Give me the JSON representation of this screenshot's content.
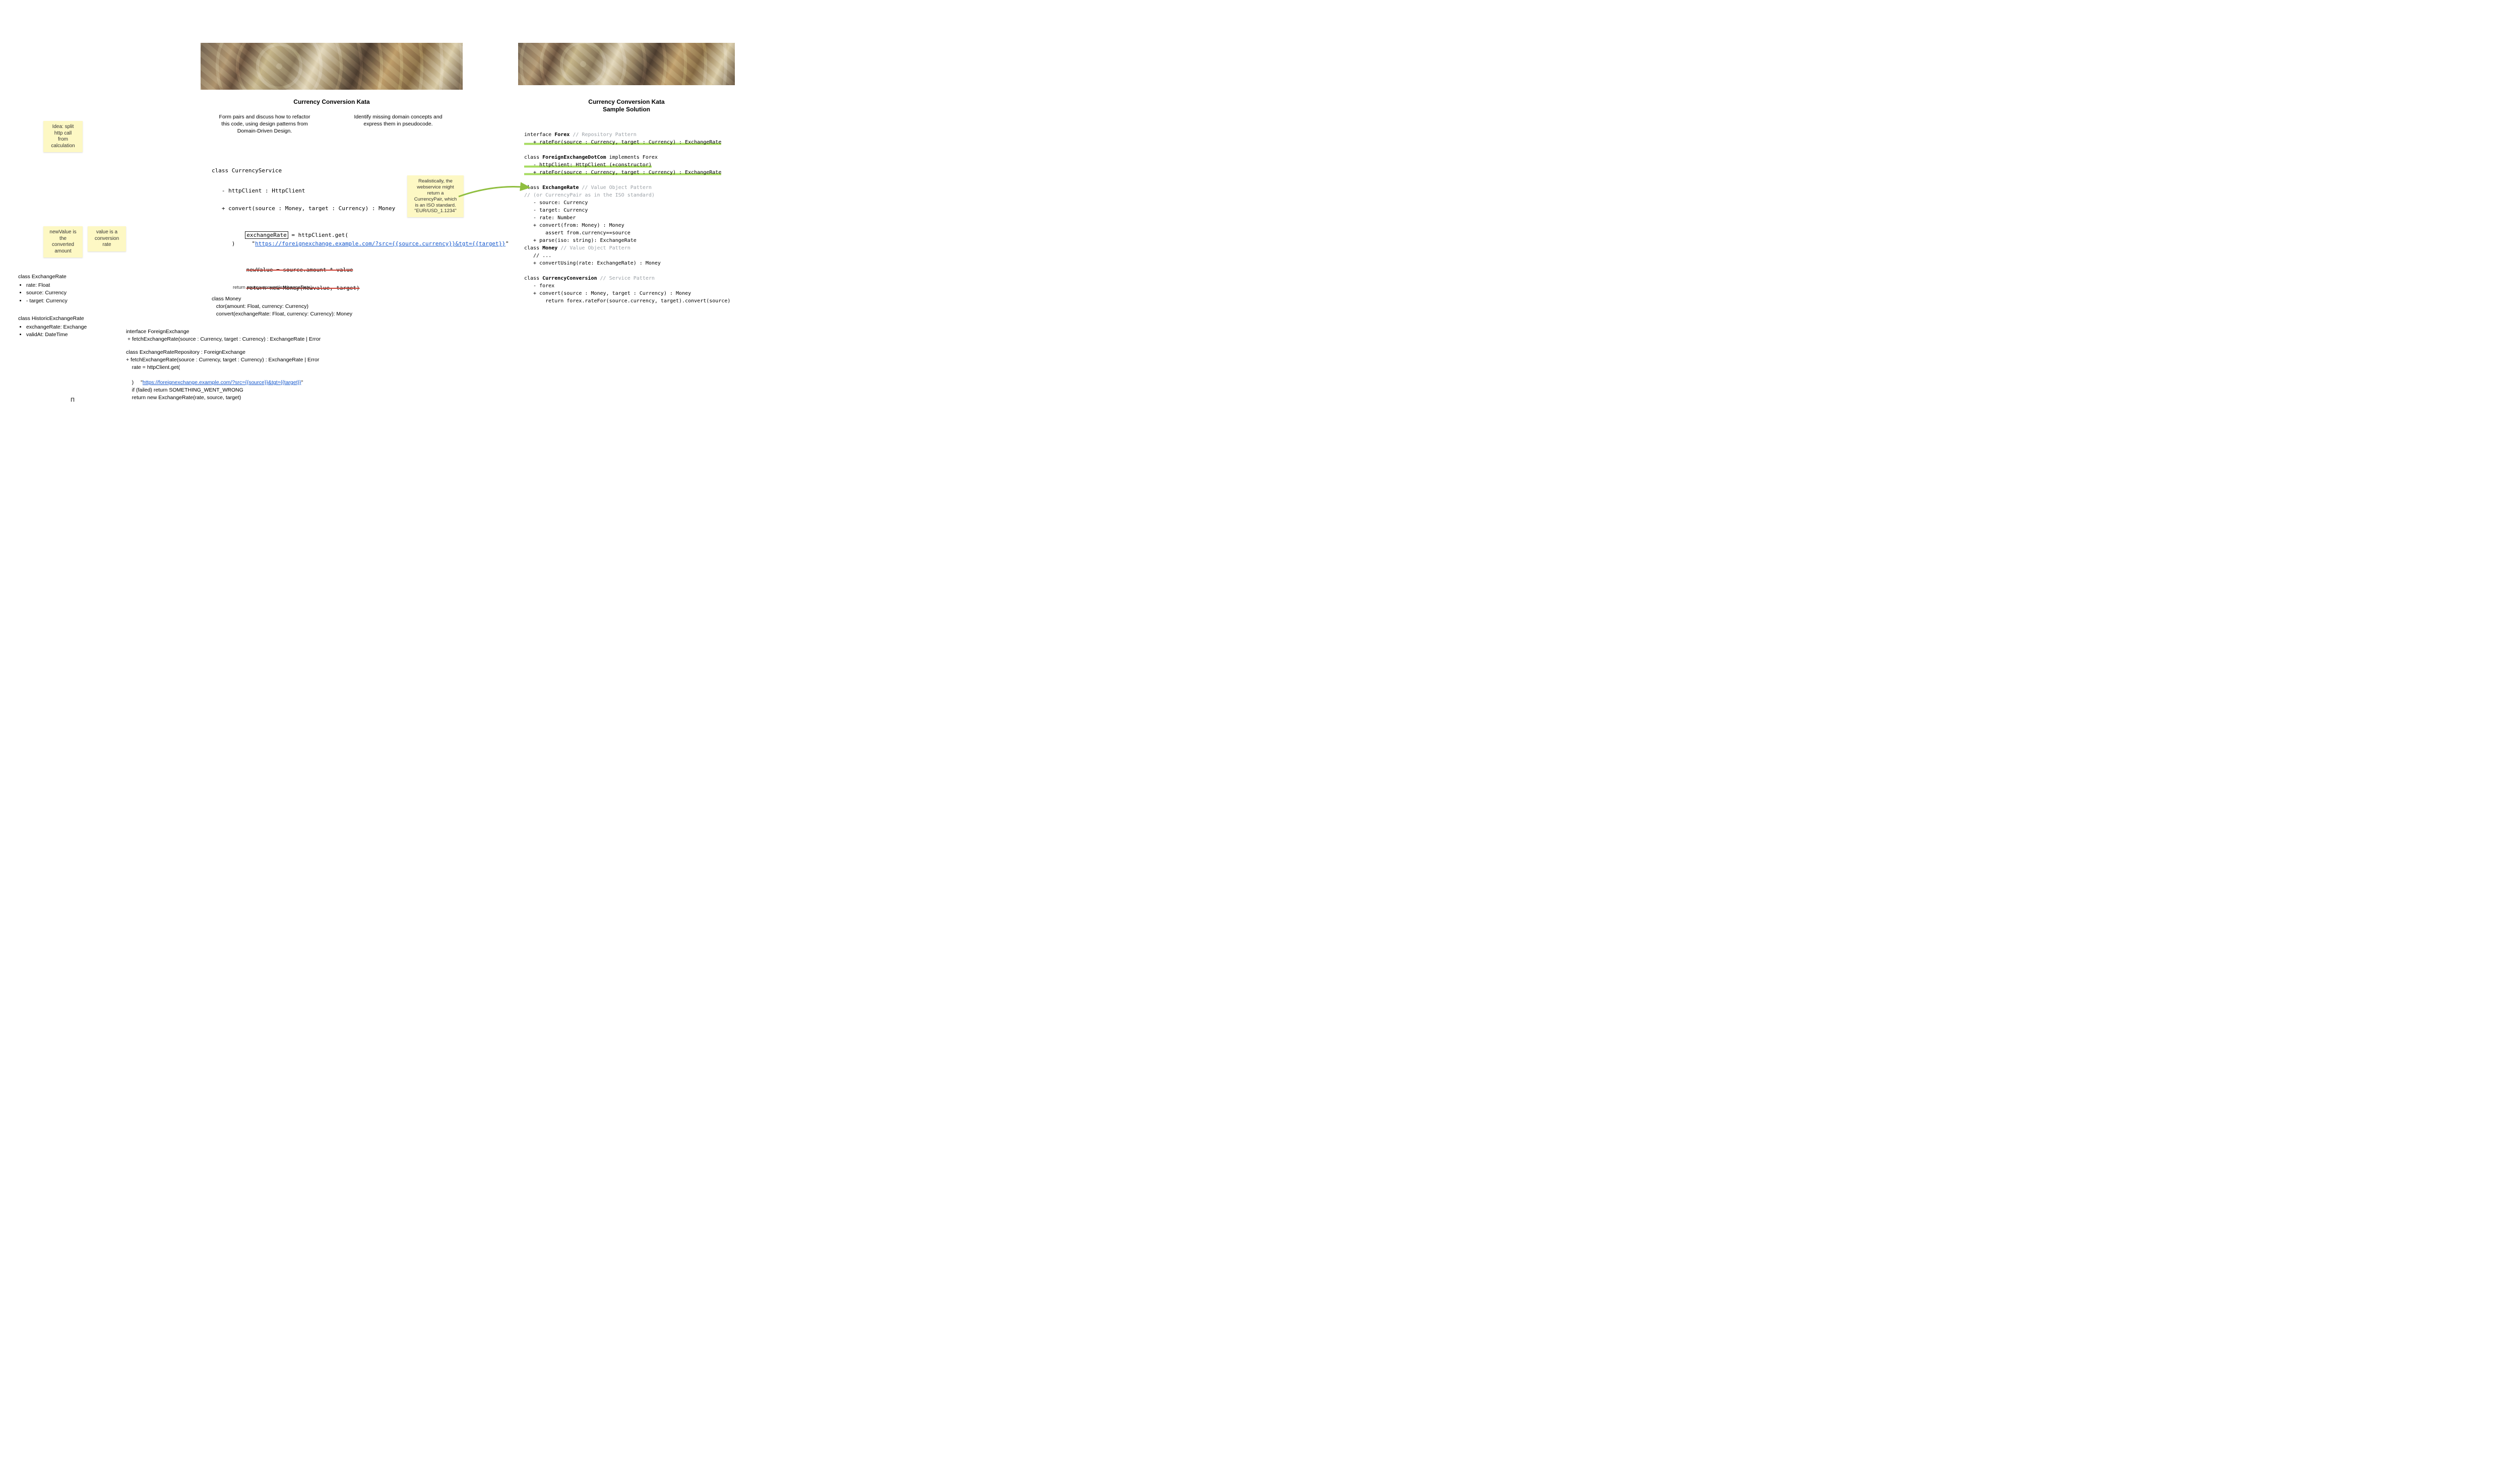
{
  "stickies": {
    "idea": "Idea: split\nhttp call\nfrom\ncalculation",
    "newValue": "newValue is\nthe\nconverted\namount",
    "valueRate": "value is a\nconversion\nrate",
    "currencyPair": "Realistically, the\nwebservice might\nreturn a\nCurrencyPair, which\nis an ISO standard.\n\"EUR/USD_1.1234\""
  },
  "leftPanel": {
    "title": "Currency Conversion Kata",
    "instrLeft": "Form pairs and discuss how to refactor\nthis code, using design patterns from\nDomain-Driven Design.",
    "instrRight": "Identify missing domain concepts and\nexpress them in pseudocode.",
    "codeHeader": "class CurrencyService",
    "field1": "   - httpClient : HttpClient",
    "method1": "   + convert(source : Money, target : Currency) : Money",
    "boxedVar": "exchangeRate",
    "httpPrefix": " = httpClient.get(",
    "urlLine": "        \"",
    "url": "https://foreignexchange.example.com/?src={{source.currency}}&tgt={{target}}",
    "urlSuffix": "\"",
    "closeParen": "      )",
    "strike1": "newValue = source.amount * value",
    "strike2": "return new Money(newvalue, target)",
    "rewrite": "return source.convert(exchangeRate)",
    "moneyBlock": "class Money\n   ctor(amount: Float, currency: Currency)\n   convert(exchangeRate: Float, currency: Currency): Money",
    "interfaceBlock": "interface ForeignExchange\n + fetchExchangeRate(source : Currency, target : Currency) : ExchangeRate | Error",
    "repoHeader": "class ExchangeRateRepository : ForeignExchange\n+ fetchExchangeRate(source : Currency, target : Currency) : ExchangeRate | Error\n    rate = httpClient.get(",
    "repoUrlPrefix": "      \"",
    "repoUrl": "https://foreignexchange.example.com/?src={{source}}&tgt={{target}}",
    "repoUrlSuffix": "\"",
    "repoTail": "    )\n    if (failed) return SOMETHING_WENT_WRONG\n    return new ExchangeRate(rate, source, target)"
  },
  "sideLists": {
    "exRate": {
      "header": "class ExchangeRate",
      "items": [
        "rate: Float",
        "source: Currency",
        "- target: Currency"
      ]
    },
    "hist": {
      "header": "class HistoricExchangeRate",
      "items": [
        "exchangeRate: Exchange",
        "validAt: DateTime"
      ]
    }
  },
  "rightPanel": {
    "title1": "Currency Conversion Kata",
    "title2": "Sample Solution",
    "lines": [
      {
        "t": "plain",
        "pre": "interface ",
        "kw": "Forex",
        "post": " ",
        "cm": "// Repository Pattern"
      },
      {
        "t": "hl",
        "text": "   + rateFor(source : Currency, target : Currency) : ExchangeRate"
      },
      {
        "t": "blank"
      },
      {
        "t": "plain",
        "pre": "class ",
        "kw": "ForeignExchangeDotCom",
        "post": " implements Forex"
      },
      {
        "t": "hl",
        "text": "   - httpClient: HttpClient (+constructor)"
      },
      {
        "t": "hl",
        "text": "   + rateFor(source : Currency, target : Currency) : ExchangeRate"
      },
      {
        "t": "blank"
      },
      {
        "t": "plain",
        "pre": "class ",
        "kw": "ExchangeRate",
        "post": " ",
        "cm": "// Value Object Pattern"
      },
      {
        "t": "cm",
        "text": "// (or CurrencyPair as in the ISO standard)"
      },
      {
        "t": "raw",
        "text": "   - source: Currency"
      },
      {
        "t": "raw",
        "text": "   - target: Currency"
      },
      {
        "t": "raw",
        "text": "   - rate: Number"
      },
      {
        "t": "raw",
        "text": "   + convert(from: Money) : Money"
      },
      {
        "t": "raw",
        "text": "       assert from.currency==source"
      },
      {
        "t": "raw",
        "text": "   + parse(iso: string): ExchangeRate"
      },
      {
        "t": "plain",
        "pre": "class ",
        "kw": "Money",
        "post": " ",
        "cm": "// Value Object Pattern"
      },
      {
        "t": "raw",
        "text": "   // ..."
      },
      {
        "t": "raw",
        "text": "   + convertUsing(rate: ExchangeRate) : Money"
      },
      {
        "t": "blank"
      },
      {
        "t": "plain",
        "pre": "class ",
        "kw": "CurrencyConversion",
        "post": " ",
        "cm": "// Service Pattern"
      },
      {
        "t": "raw",
        "text": "   - forex"
      },
      {
        "t": "raw",
        "text": "   + convert(source : Money, target : Currency) : Money"
      },
      {
        "t": "raw",
        "text": "       return forex.rateFor(source.currency, target).convert(source)"
      }
    ]
  },
  "cursorGlyph": "Π"
}
